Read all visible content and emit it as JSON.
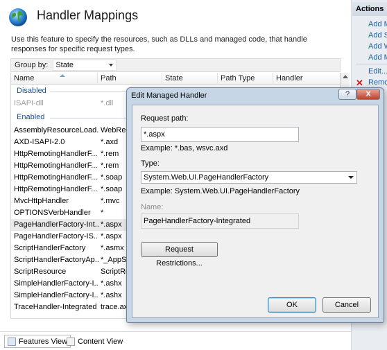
{
  "feature": {
    "title": "Handler Mappings",
    "description": "Use this feature to specify the resources, such as DLLs and managed code, that handle responses for specific request types.",
    "group_by_label": "Group by:",
    "group_by_value": "State"
  },
  "grid": {
    "columns": [
      "Name",
      "Path",
      "State",
      "Path Type",
      "Handler"
    ],
    "groups": [
      {
        "label": "Disabled",
        "rows": [
          {
            "name": "ISAPI-dll",
            "path": "*.dll"
          }
        ]
      },
      {
        "label": "Enabled",
        "rows": [
          {
            "name": "AssemblyResourceLoad...",
            "path": "WebRes"
          },
          {
            "name": "AXD-ISAPI-2.0",
            "path": "*.axd"
          },
          {
            "name": "HttpRemotingHandlerF...",
            "path": "*.rem"
          },
          {
            "name": "HttpRemotingHandlerF...",
            "path": "*.rem"
          },
          {
            "name": "HttpRemotingHandlerF...",
            "path": "*.soap"
          },
          {
            "name": "HttpRemotingHandlerF...",
            "path": "*.soap"
          },
          {
            "name": "MvcHttpHandler",
            "path": "*.mvc"
          },
          {
            "name": "OPTIONSVerbHandler",
            "path": "*"
          },
          {
            "name": "PageHandlerFactory-Int...",
            "path": "*.aspx"
          },
          {
            "name": "PageHandlerFactory-IS...",
            "path": "*.aspx"
          },
          {
            "name": "ScriptHandlerFactory",
            "path": "*.asmx"
          },
          {
            "name": "ScriptHandlerFactoryAp...",
            "path": "*_AppSe"
          },
          {
            "name": "ScriptResource",
            "path": "ScriptRe"
          },
          {
            "name": "SimpleHandlerFactory-I...",
            "path": "*.ashx"
          },
          {
            "name": "SimpleHandlerFactory-I...",
            "path": "*.ashx"
          },
          {
            "name": "TraceHandler-Integrated",
            "path": "trace.axd"
          }
        ]
      }
    ]
  },
  "view_tabs": {
    "features": "Features View",
    "content": "Content View"
  },
  "actions": {
    "header": "Actions",
    "items": [
      "Add M",
      "Add S",
      "Add W",
      "Add M"
    ],
    "edit": "Edit...",
    "remove": "Remo"
  },
  "dialog": {
    "title": "Edit Managed Handler",
    "help_glyph": "?",
    "close_glyph": "X",
    "request_path_label": "Request path:",
    "request_path_value": "*.aspx",
    "request_path_example": "Example: *.bas, wsvc.axd",
    "type_label": "Type:",
    "type_value": "System.Web.UI.PageHandlerFactory",
    "type_example": "Example: System.Web.UI.PageHandlerFactory",
    "name_label": "Name:",
    "name_value": "PageHandlerFactory-Integrated",
    "restrictions_button": "Request Restrictions...",
    "ok": "OK",
    "cancel": "Cancel"
  }
}
